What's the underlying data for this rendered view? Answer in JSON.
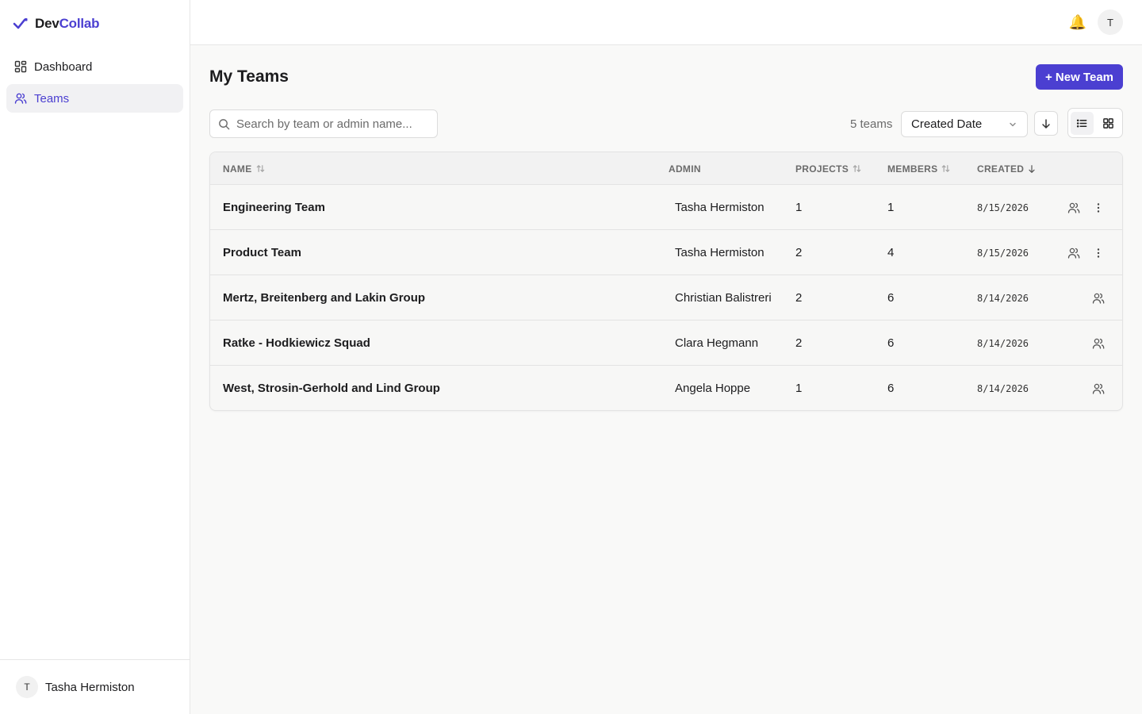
{
  "app": {
    "brand_part1": "Dev",
    "brand_part2": "Collab",
    "accent": "#4b3fd1"
  },
  "sidebar": {
    "items": [
      {
        "label": "Dashboard",
        "icon": "dashboard-grid-icon",
        "active": false
      },
      {
        "label": "Teams",
        "icon": "users-icon",
        "active": true
      }
    ],
    "user": {
      "initial": "T",
      "name": "Tasha Hermiston"
    }
  },
  "topbar": {
    "bell_icon": "bell-icon",
    "avatar_initial": "T"
  },
  "page": {
    "title": "My Teams",
    "new_team_label": "+ New Team"
  },
  "toolbar": {
    "search_placeholder": "Search by team or admin name...",
    "count": "5 teams",
    "sort_value": "Created Date"
  },
  "table": {
    "headers": {
      "name": "NAME",
      "admin": "ADMIN",
      "projects": "PROJECTS",
      "members": "MEMBERS",
      "created": "CREATED"
    },
    "rows": [
      {
        "name": "Engineering Team",
        "admin": "Tasha Hermiston",
        "projects": "1",
        "members": "1",
        "created": "8/15/2026",
        "owner": true
      },
      {
        "name": "Product Team",
        "admin": "Tasha Hermiston",
        "projects": "2",
        "members": "4",
        "created": "8/15/2026",
        "owner": true
      },
      {
        "name": "Mertz, Breitenberg and Lakin Group",
        "admin": "Christian Balistreri",
        "projects": "2",
        "members": "6",
        "created": "8/14/2026",
        "owner": false
      },
      {
        "name": "Ratke - Hodkiewicz Squad",
        "admin": "Clara Hegmann",
        "projects": "2",
        "members": "6",
        "created": "8/14/2026",
        "owner": false
      },
      {
        "name": "West, Strosin-Gerhold and Lind Group",
        "admin": "Angela Hoppe",
        "projects": "1",
        "members": "6",
        "created": "8/14/2026",
        "owner": false
      }
    ]
  }
}
